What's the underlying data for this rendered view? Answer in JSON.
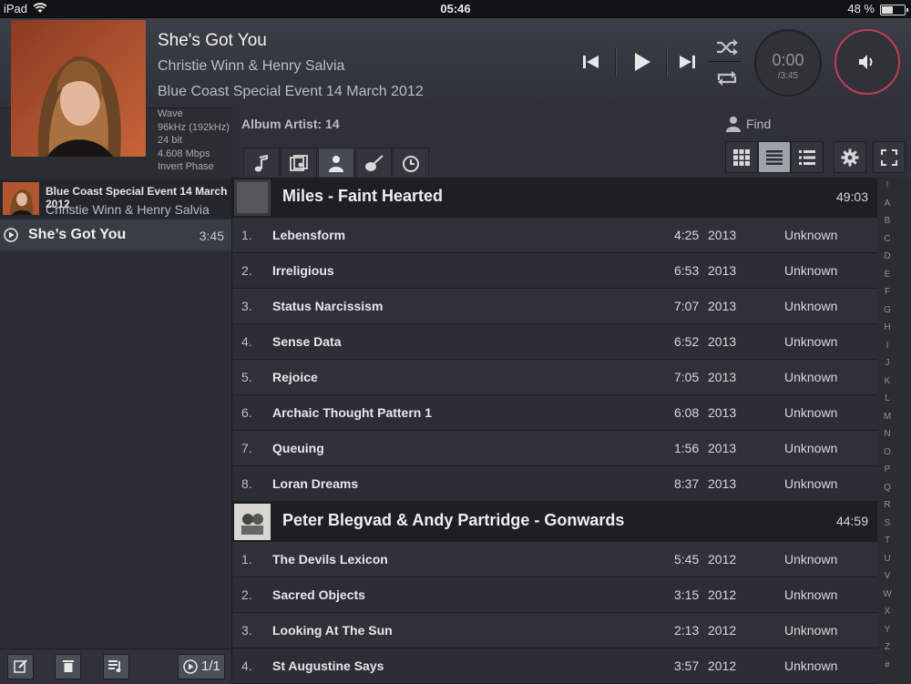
{
  "status": {
    "device": "iPad",
    "time": "05:46",
    "battery": "48 %",
    "battery_level": 0.48
  },
  "now_playing": {
    "title": "She's Got You",
    "artist": "Christie Winn & Henry Salvia",
    "album": "Blue Coast Special Event 14 March 2012",
    "meta": [
      "Wave",
      "96kHz (192kHz)",
      "24 bit",
      "4.608 Mbps",
      "Invert Phase"
    ],
    "elapsed": "0:00",
    "total": "/3:45"
  },
  "browser": {
    "crumb": "Album Artist: 14",
    "find": "Find",
    "tabs": [
      "songs-tab",
      "albums-tab",
      "artists-tab",
      "genres-tab",
      "recent-tab"
    ],
    "views": [
      "grid-view",
      "list-view",
      "detail-view"
    ]
  },
  "playlist": {
    "group_title": "Blue Coast Special Event 14 March 2012",
    "group_artist": "Christie Winn & Henry Salvia",
    "items": [
      {
        "title": "She’s Got You",
        "duration": "3:45"
      }
    ],
    "page": "1/1"
  },
  "albums": [
    {
      "title": "Miles - Faint Hearted",
      "duration": "49:03",
      "tracks": [
        {
          "n": "1.",
          "title": "Lebensform",
          "dur": "4:25",
          "year": "2013",
          "genre": "Unknown"
        },
        {
          "n": "2.",
          "title": "Irreligious",
          "dur": "6:53",
          "year": "2013",
          "genre": "Unknown"
        },
        {
          "n": "3.",
          "title": "Status Narcissism",
          "dur": "7:07",
          "year": "2013",
          "genre": "Unknown"
        },
        {
          "n": "4.",
          "title": "Sense Data",
          "dur": "6:52",
          "year": "2013",
          "genre": "Unknown"
        },
        {
          "n": "5.",
          "title": "Rejoice",
          "dur": "7:05",
          "year": "2013",
          "genre": "Unknown"
        },
        {
          "n": "6.",
          "title": "Archaic Thought Pattern 1",
          "dur": "6:08",
          "year": "2013",
          "genre": "Unknown"
        },
        {
          "n": "7.",
          "title": "Queuing",
          "dur": "1:56",
          "year": "2013",
          "genre": "Unknown"
        },
        {
          "n": "8.",
          "title": "Loran Dreams",
          "dur": "8:37",
          "year": "2013",
          "genre": "Unknown"
        }
      ]
    },
    {
      "title": "Peter Blegvad & Andy Partridge - Gonwards",
      "duration": "44:59",
      "tracks": [
        {
          "n": "1.",
          "title": "The Devils Lexicon",
          "dur": "5:45",
          "year": "2012",
          "genre": "Unknown"
        },
        {
          "n": "2.",
          "title": "Sacred Objects",
          "dur": "3:15",
          "year": "2012",
          "genre": "Unknown"
        },
        {
          "n": "3.",
          "title": "Looking At The Sun",
          "dur": "2:13",
          "year": "2012",
          "genre": "Unknown"
        },
        {
          "n": "4.",
          "title": "St Augustine Says",
          "dur": "3:57",
          "year": "2012",
          "genre": "Unknown"
        }
      ]
    }
  ],
  "index": [
    "!",
    "A",
    "B",
    "C",
    "D",
    "E",
    "F",
    "G",
    "H",
    "I",
    "J",
    "K",
    "L",
    "M",
    "N",
    "O",
    "P",
    "Q",
    "R",
    "S",
    "T",
    "U",
    "V",
    "W",
    "X",
    "Y",
    "Z",
    "#"
  ]
}
